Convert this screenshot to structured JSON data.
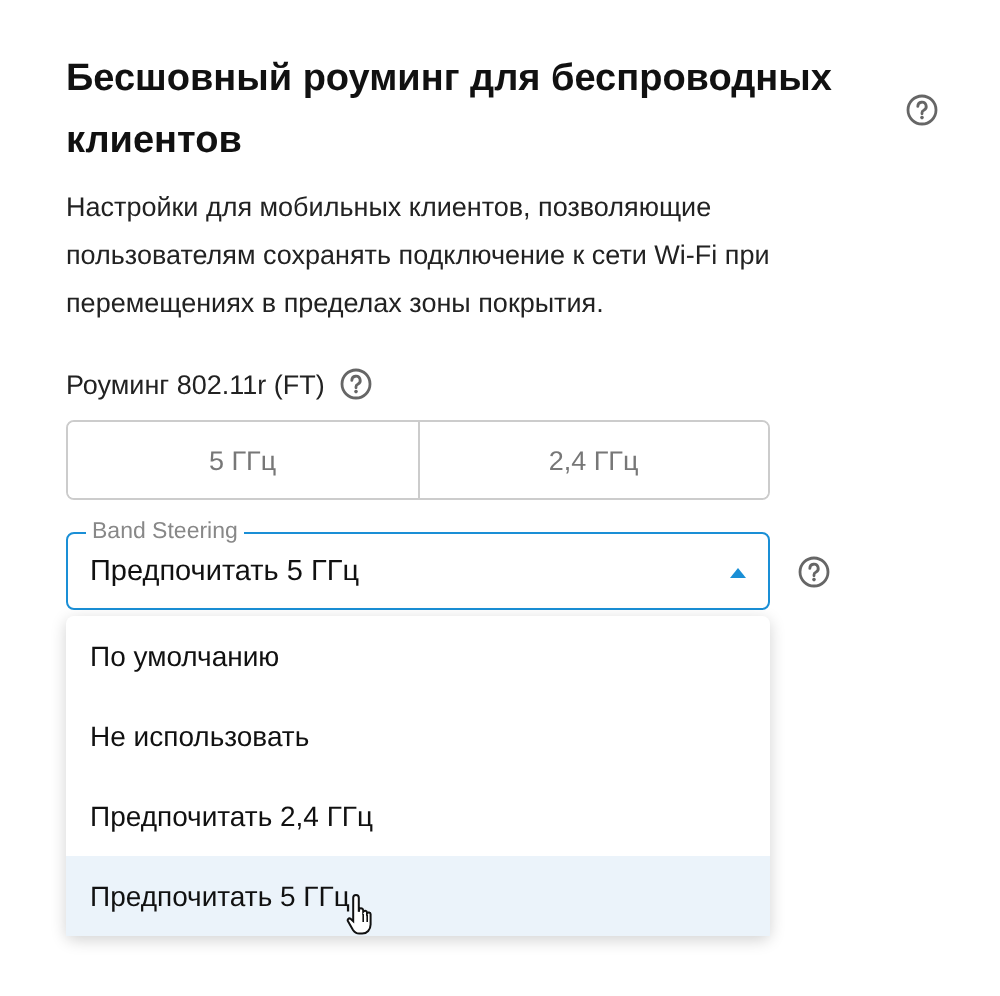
{
  "section": {
    "title": "Бесшовный роуминг для беспроводных клиентов",
    "description": "Настройки для мобильных клиентов, позволяющие пользователям сохранять подключение к сети Wi-Fi при перемещениях в пределах зоны покрытия."
  },
  "roaming": {
    "label": "Роуминг 802.11r (FT)",
    "options": [
      {
        "label": "5 ГГц",
        "selected": false
      },
      {
        "label": "2,4 ГГц",
        "selected": false
      }
    ]
  },
  "band_steering": {
    "label": "Band Steering",
    "value": "Предпочитать 5 ГГц",
    "expanded": true,
    "options": [
      {
        "label": "По умолчанию",
        "hovered": false
      },
      {
        "label": "Не использовать",
        "hovered": false
      },
      {
        "label": "Предпочитать 2,4 ГГц",
        "hovered": false
      },
      {
        "label": "Предпочитать 5 ГГц",
        "hovered": true
      }
    ]
  }
}
